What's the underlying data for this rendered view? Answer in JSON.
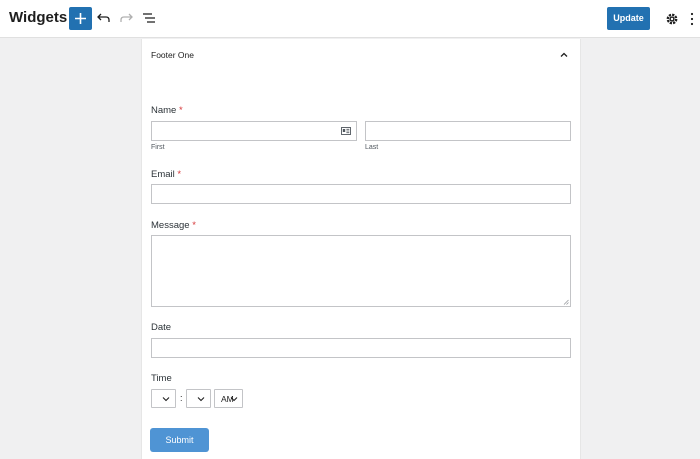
{
  "header": {
    "title": "Widgets",
    "update_label": "Update"
  },
  "widget": {
    "title": "Footer One"
  },
  "form": {
    "name_label": "Name",
    "required_mark": "*",
    "first_label": "First",
    "last_label": "Last",
    "first_value": "",
    "last_value": "",
    "email_label": "Email",
    "email_value": "",
    "message_label": "Message",
    "message_value": "",
    "date_label": "Date",
    "date_value": "",
    "time_label": "Time",
    "time_separator": ":",
    "ampm_value": "AM",
    "submit_label": "Submit"
  },
  "colors": {
    "primary": "#2271b1",
    "submit": "#4f94d4",
    "required": "#d63638"
  }
}
